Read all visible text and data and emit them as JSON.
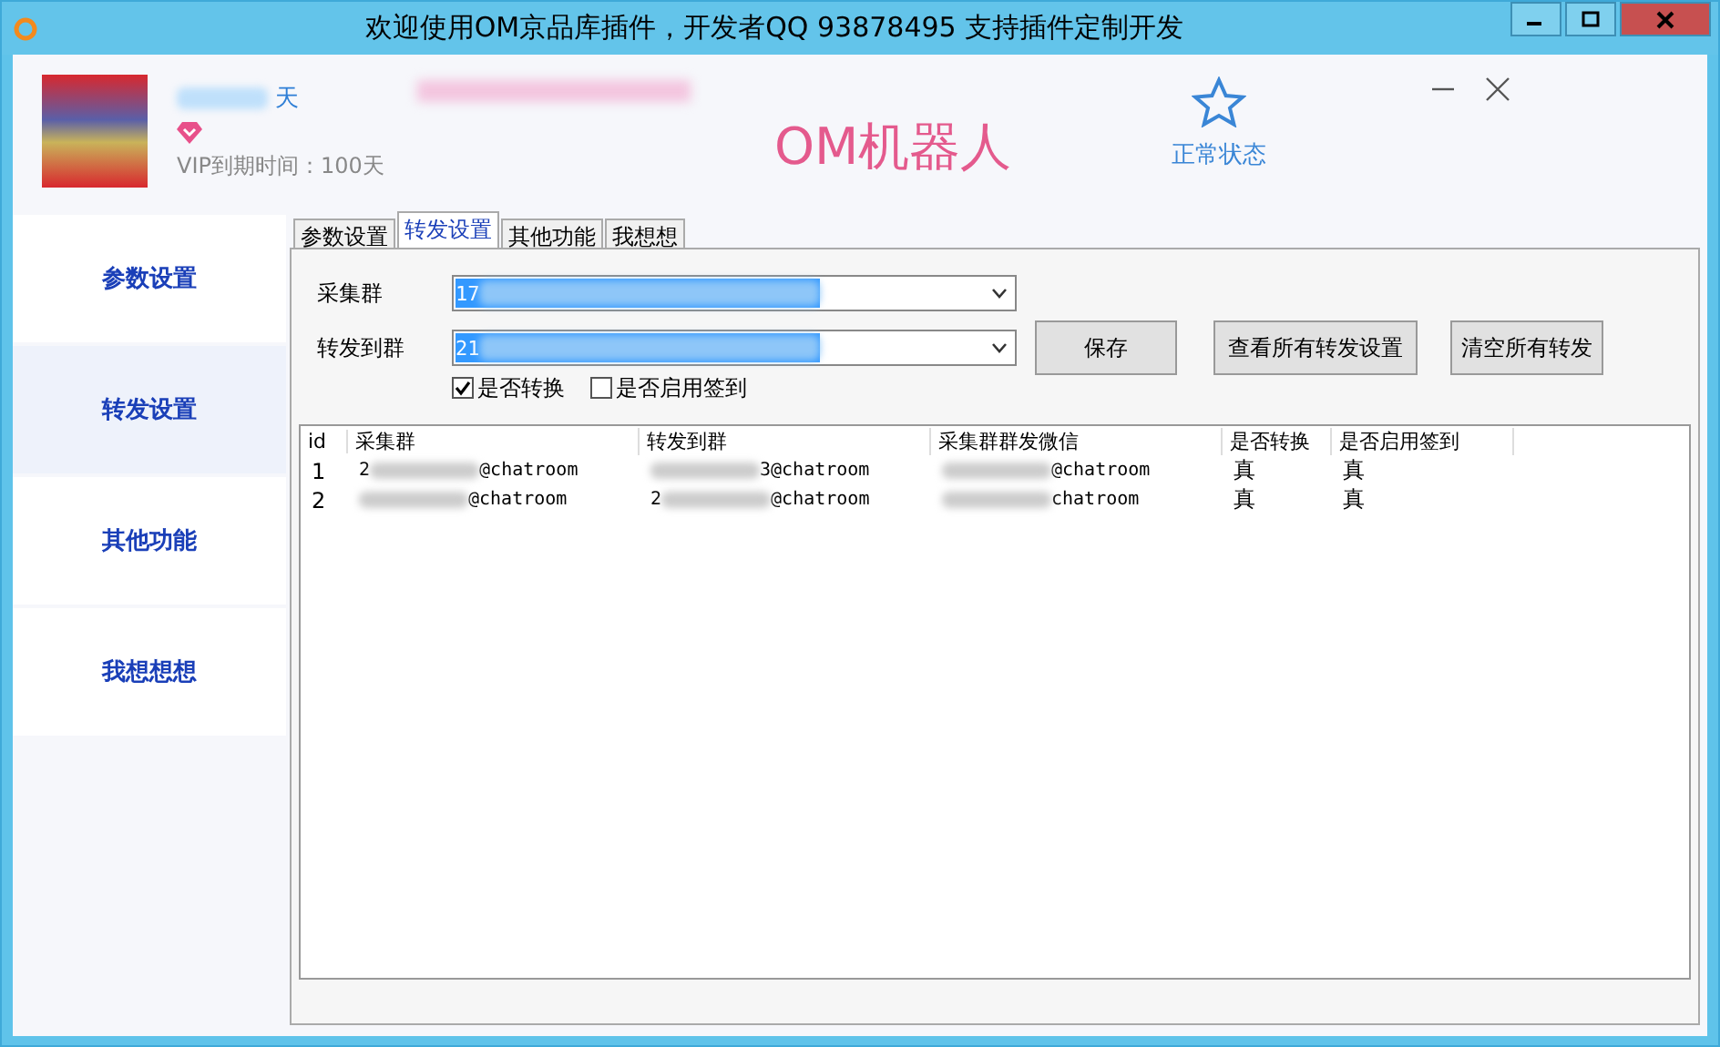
{
  "window": {
    "title": "欢迎使用OM京品库插件，开发者QQ 93878495 支持插件定制开发"
  },
  "profile": {
    "name": "天",
    "vip": "VIP到期时间：100天"
  },
  "app_title": "OM机器人",
  "status": {
    "label": "正常状态"
  },
  "sidebar": {
    "items": [
      {
        "label": "参数设置",
        "selected": false
      },
      {
        "label": "转发设置",
        "selected": true
      },
      {
        "label": "其他功能",
        "selected": false
      },
      {
        "label": "我想想想",
        "selected": false
      }
    ]
  },
  "tabs": [
    {
      "label": "参数设置",
      "selected": false
    },
    {
      "label": "转发设置",
      "selected": true
    },
    {
      "label": "其他功能",
      "selected": false
    },
    {
      "label": "我想想",
      "selected": false
    }
  ],
  "form": {
    "source": {
      "label": "采集群",
      "value": "17"
    },
    "target": {
      "label": "转发到群",
      "value": "21"
    },
    "checks": [
      {
        "label": "是否转换",
        "checked": true
      },
      {
        "label": "是否启用签到",
        "checked": false
      }
    ],
    "buttons": [
      "保存",
      "查看所有转发设置",
      "清空所有转发"
    ]
  },
  "table": {
    "columns": [
      "id",
      "采集群",
      "转发到群",
      "采集群群发微信",
      "是否转换",
      "是否启用签到"
    ],
    "rows": [
      [
        "1",
        {
          "lead": "2",
          "tail": "@chatroom"
        },
        {
          "tail": "3@chatroom"
        },
        {
          "tail": "@chatroom"
        },
        "真",
        "真"
      ],
      [
        "2",
        {
          "tail": "@chatroom"
        },
        {
          "lead": "2",
          "tail": "@chatroom"
        },
        {
          "tail": "chatroom"
        },
        "真",
        "真"
      ]
    ]
  }
}
